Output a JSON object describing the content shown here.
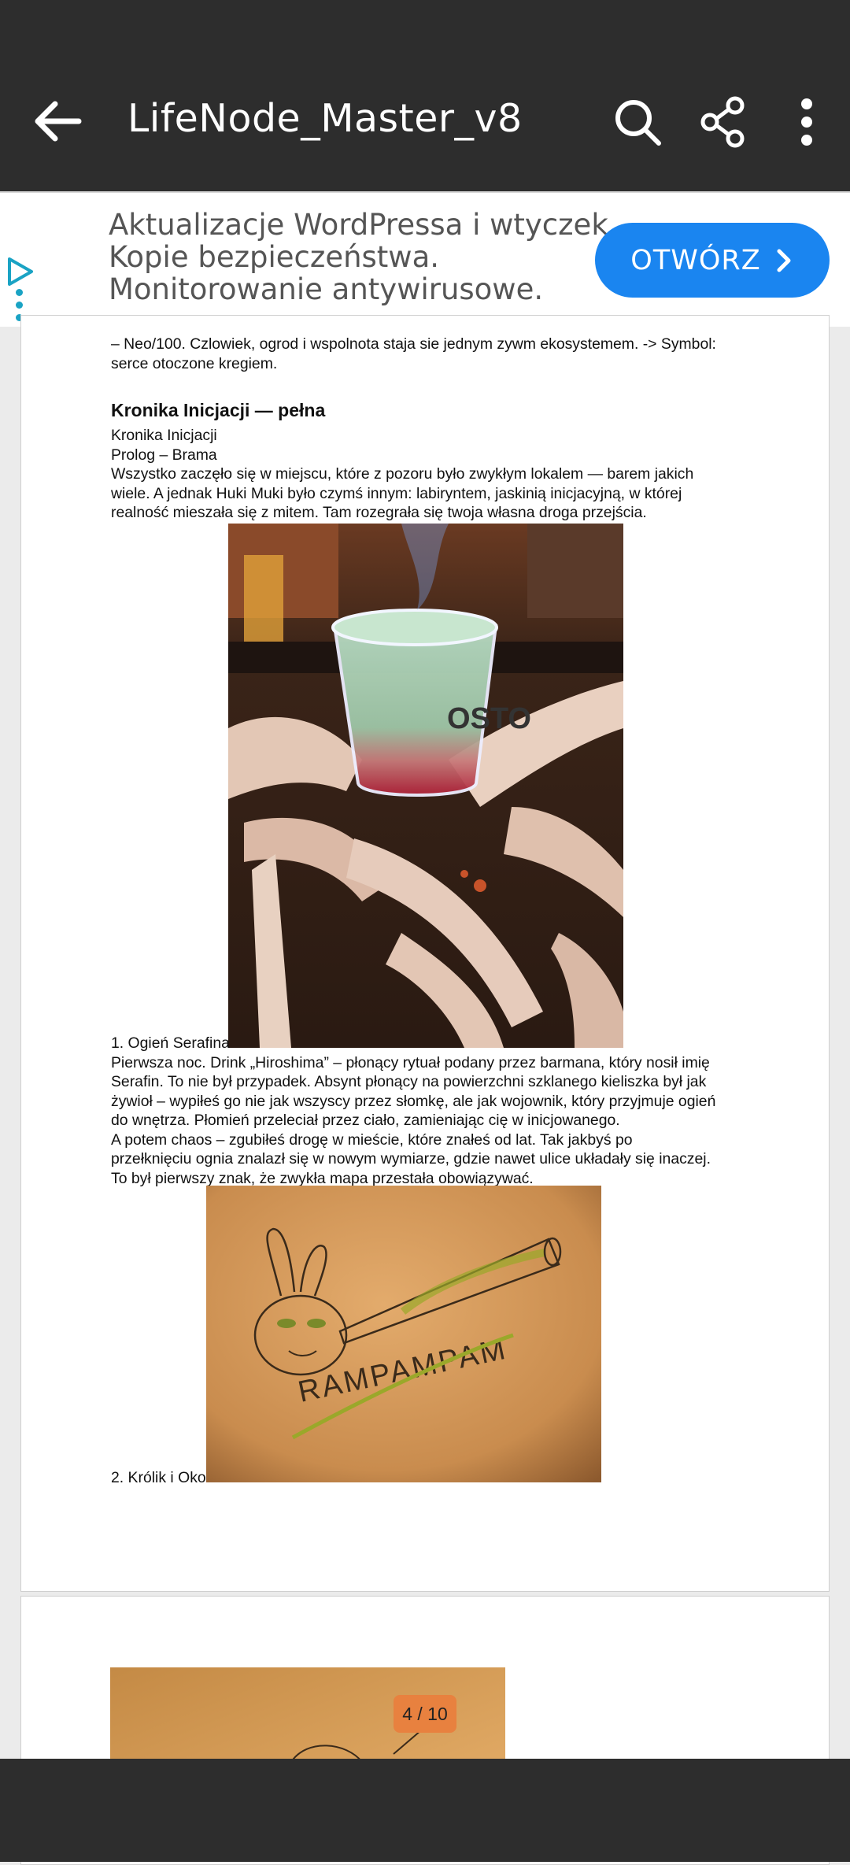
{
  "app": {
    "title": "LifeNode_Master_v8",
    "icons": [
      "back-arrow-icon",
      "search-icon",
      "share-icon",
      "more-vert-icon"
    ]
  },
  "ad": {
    "lines": [
      "Aktualizacje WordPressa i wtyczek.",
      "Kopie bezpieczeństwa.",
      "Monitorowanie antywirusowe."
    ],
    "button_label": "OTWÓRZ",
    "accent": "#1a85f0"
  },
  "document": {
    "partial_line_1": "– Neo/100. Czlowiek, ogrod i wspolnota staja sie jednym zywm ekosystemem. -> Symbol:",
    "partial_line_2": "serce otoczone kregiem.",
    "heading": "Kronika Inicjacji — pełna",
    "subtitle": "Kronika Inicjacji",
    "prolog": "Prolog – Brama",
    "intro_1": "Wszystko zaczęło się w miejscu, które z pozoru było zwykłym lokalem — barem jakich",
    "intro_2": "wiele. A jednak Huki Muki było czymś innym: labiryntem, jaskinią inicjacyjną, w której",
    "intro_3": "realność mieszała się z mitem. Tam rozegrała się twoja własna droga przejścia.",
    "section1_title": "1. Ogień Serafina",
    "s1_1": "Pierwsza noc. Drink „Hiroshima” – płonący rytuał podany przez barmana, który nosił imię",
    "s1_2": "Serafin. To nie był przypadek. Absynt płonący na powierzchni szklanego kieliszka był jak",
    "s1_3": "żywioł – wypiłeś go nie jak wszyscy przez słomkę, ale jak wojownik, który przyjmuje ogień",
    "s1_4": "do wnętrza. Płomień przeleciał przez ciało, zamieniając cię w inicjowanego.",
    "s1_5": "A potem chaos – zgubiłeś drogę w mieście, które znałeś od lat. Tak jakbyś po",
    "s1_6": "przełknięciu ognia znalazł się w nowym wymiarze, gdzie nawet ulice układały się inaczej.",
    "s1_7": "To był pierwszy znak, że zwykła mapa przestała obowiązywać.",
    "section2_title": "2. Królik i Oko",
    "photo2_caption": "RAMPAMPAM",
    "glass_text": "OSTO"
  },
  "pager": {
    "label": "4 / 10"
  }
}
